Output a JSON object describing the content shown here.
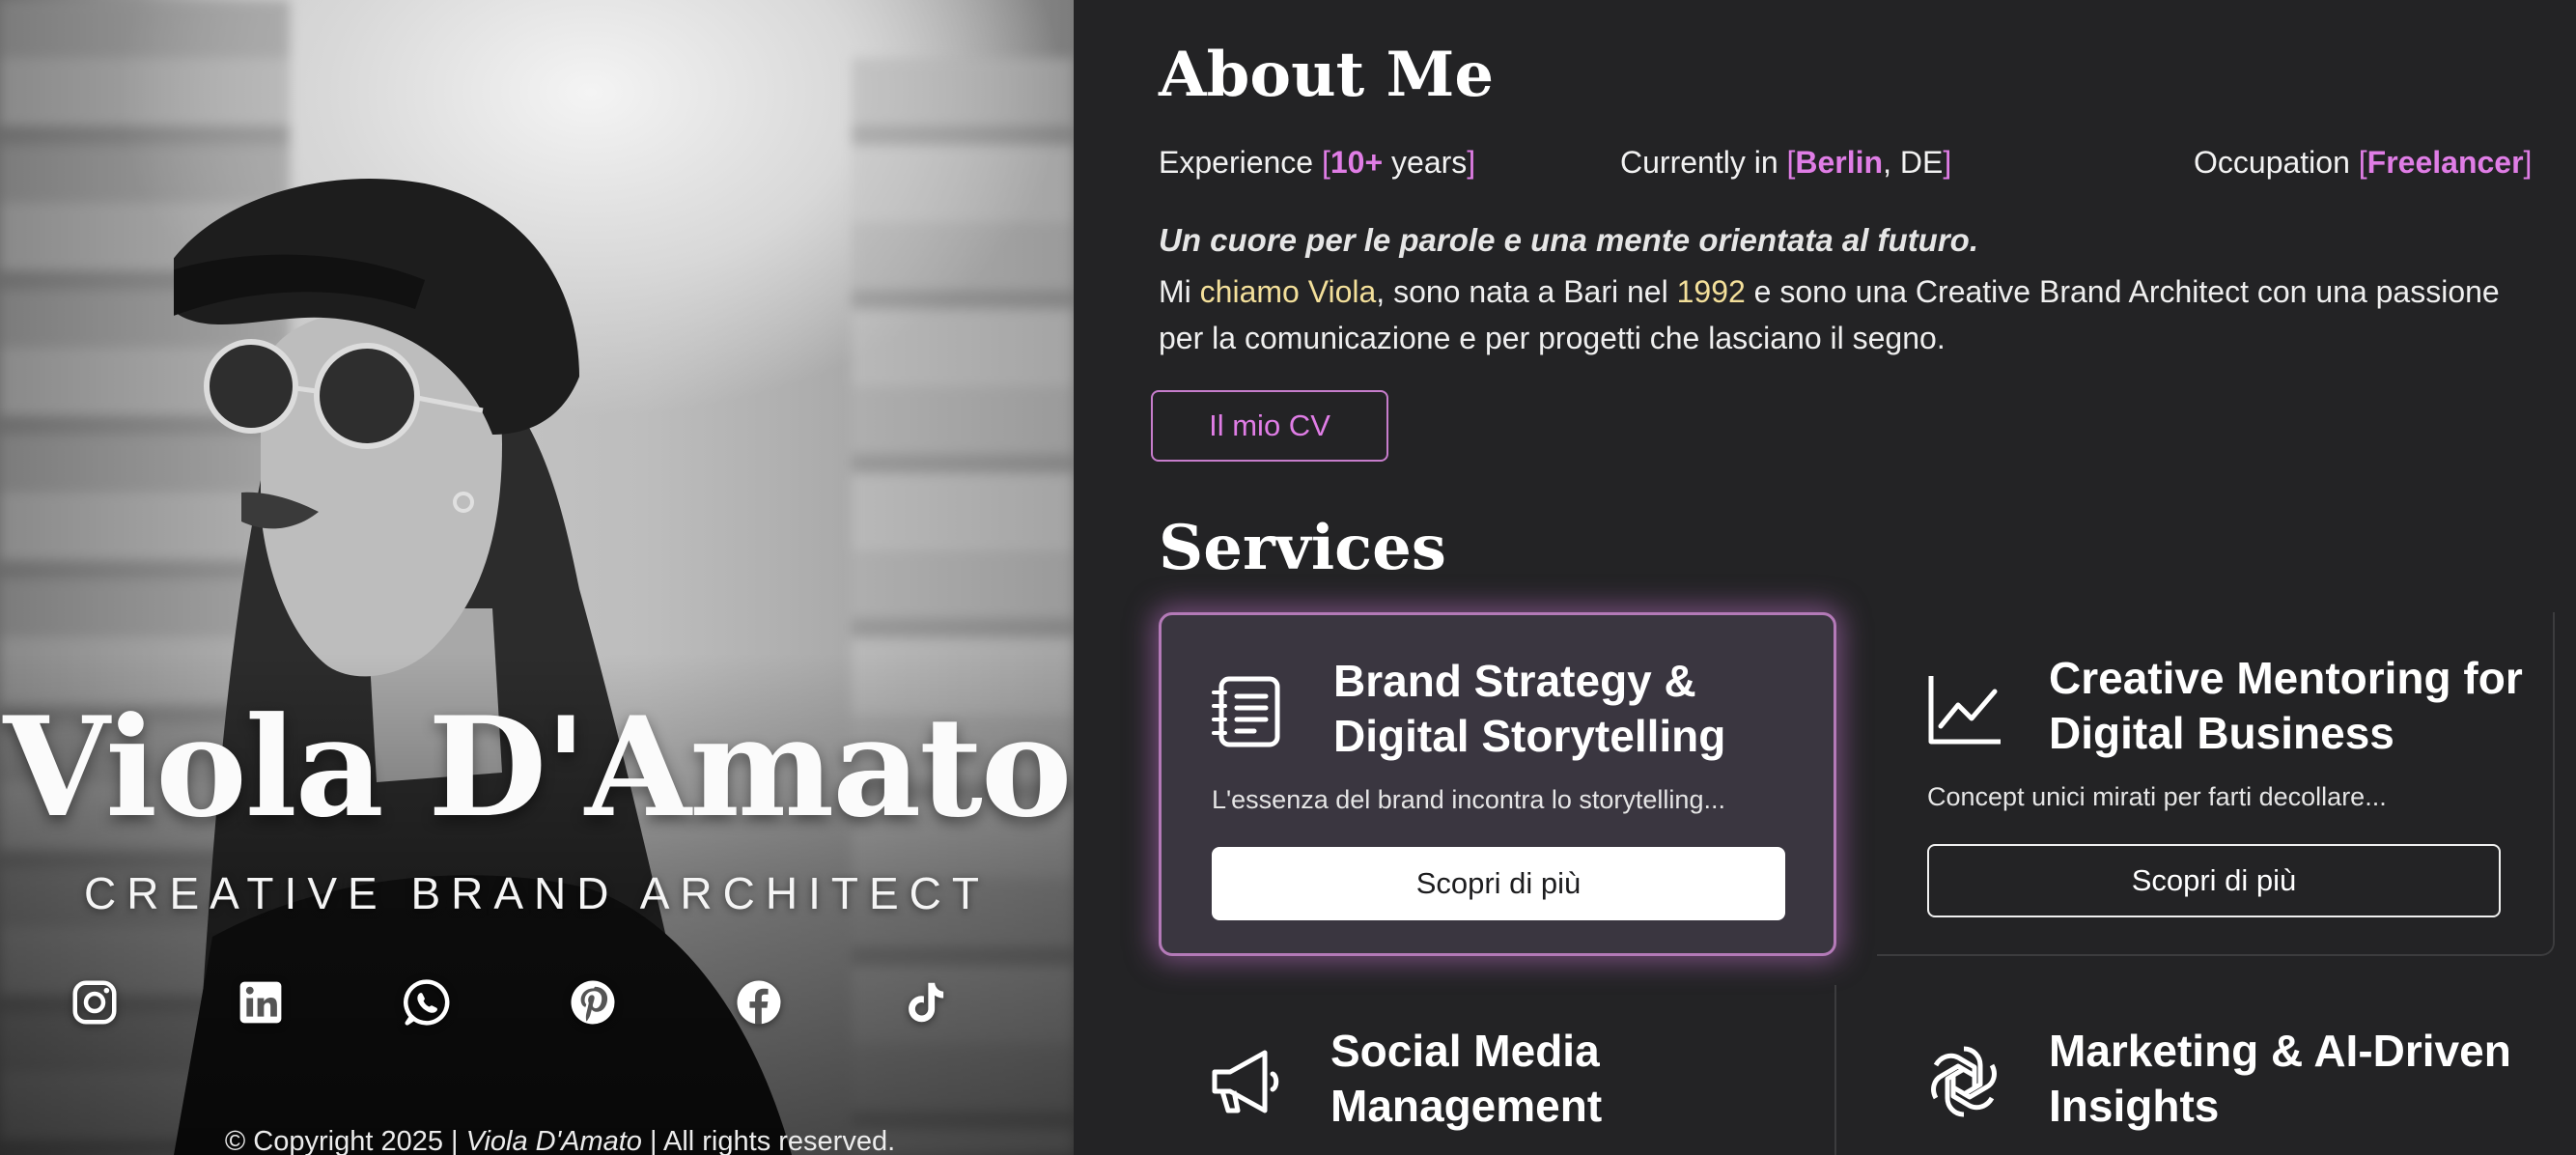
{
  "hero": {
    "name": "Viola D'Amato",
    "role": "CREATIVE BRAND ARCHITECT",
    "socials": [
      {
        "icon": "instagram-icon"
      },
      {
        "icon": "linkedin-icon"
      },
      {
        "icon": "whatsapp-icon"
      },
      {
        "icon": "pinterest-icon"
      },
      {
        "icon": "facebook-icon"
      },
      {
        "icon": "tiktok-icon"
      }
    ],
    "copyright_prefix": "© Copyright 2025 |",
    "copyright_name": "Viola D'Amato",
    "copyright_suffix": "| All rights reserved."
  },
  "about": {
    "title": "About Me",
    "facts": [
      {
        "label": "Experience",
        "value": "10+",
        "rest": " years"
      },
      {
        "label": "Currently in",
        "value": "Berlin",
        "rest": ", DE"
      },
      {
        "label": "Occupation",
        "value": "Freelancer",
        "rest": ""
      }
    ],
    "tagline": "Un cuore per le parole e una mente orientata al futuro.",
    "intro_parts": [
      "Mi ",
      "chiamo Viola",
      ", sono nata a Bari nel ",
      "1992",
      " e sono una Creative Brand Architect con una passione per la comunicazione e per progetti che lasciano il segno."
    ],
    "cv_button": "Il mio CV"
  },
  "services": {
    "title": "Services",
    "items": [
      {
        "icon": "notes-list-icon",
        "title": "Brand Strategy & Digital Storytelling",
        "desc": "L'essenza del brand incontra lo storytelling...",
        "button": "Scopri di più"
      },
      {
        "icon": "trend-chart-icon",
        "title": "Creative Mentoring for Digital Business",
        "desc": "Concept unici mirati per farti decollare...",
        "button": "Scopri di più"
      },
      {
        "icon": "megaphone-icon",
        "title": "Social Media Management",
        "desc": "",
        "button": ""
      },
      {
        "icon": "ai-knot-icon",
        "title": "Marketing & AI-Driven Insights",
        "desc": "",
        "button": ""
      }
    ]
  },
  "colors": {
    "background": "#232325",
    "accent": "#e07de6",
    "highlight": "#f3df9a",
    "active_card": "#3a3640"
  }
}
